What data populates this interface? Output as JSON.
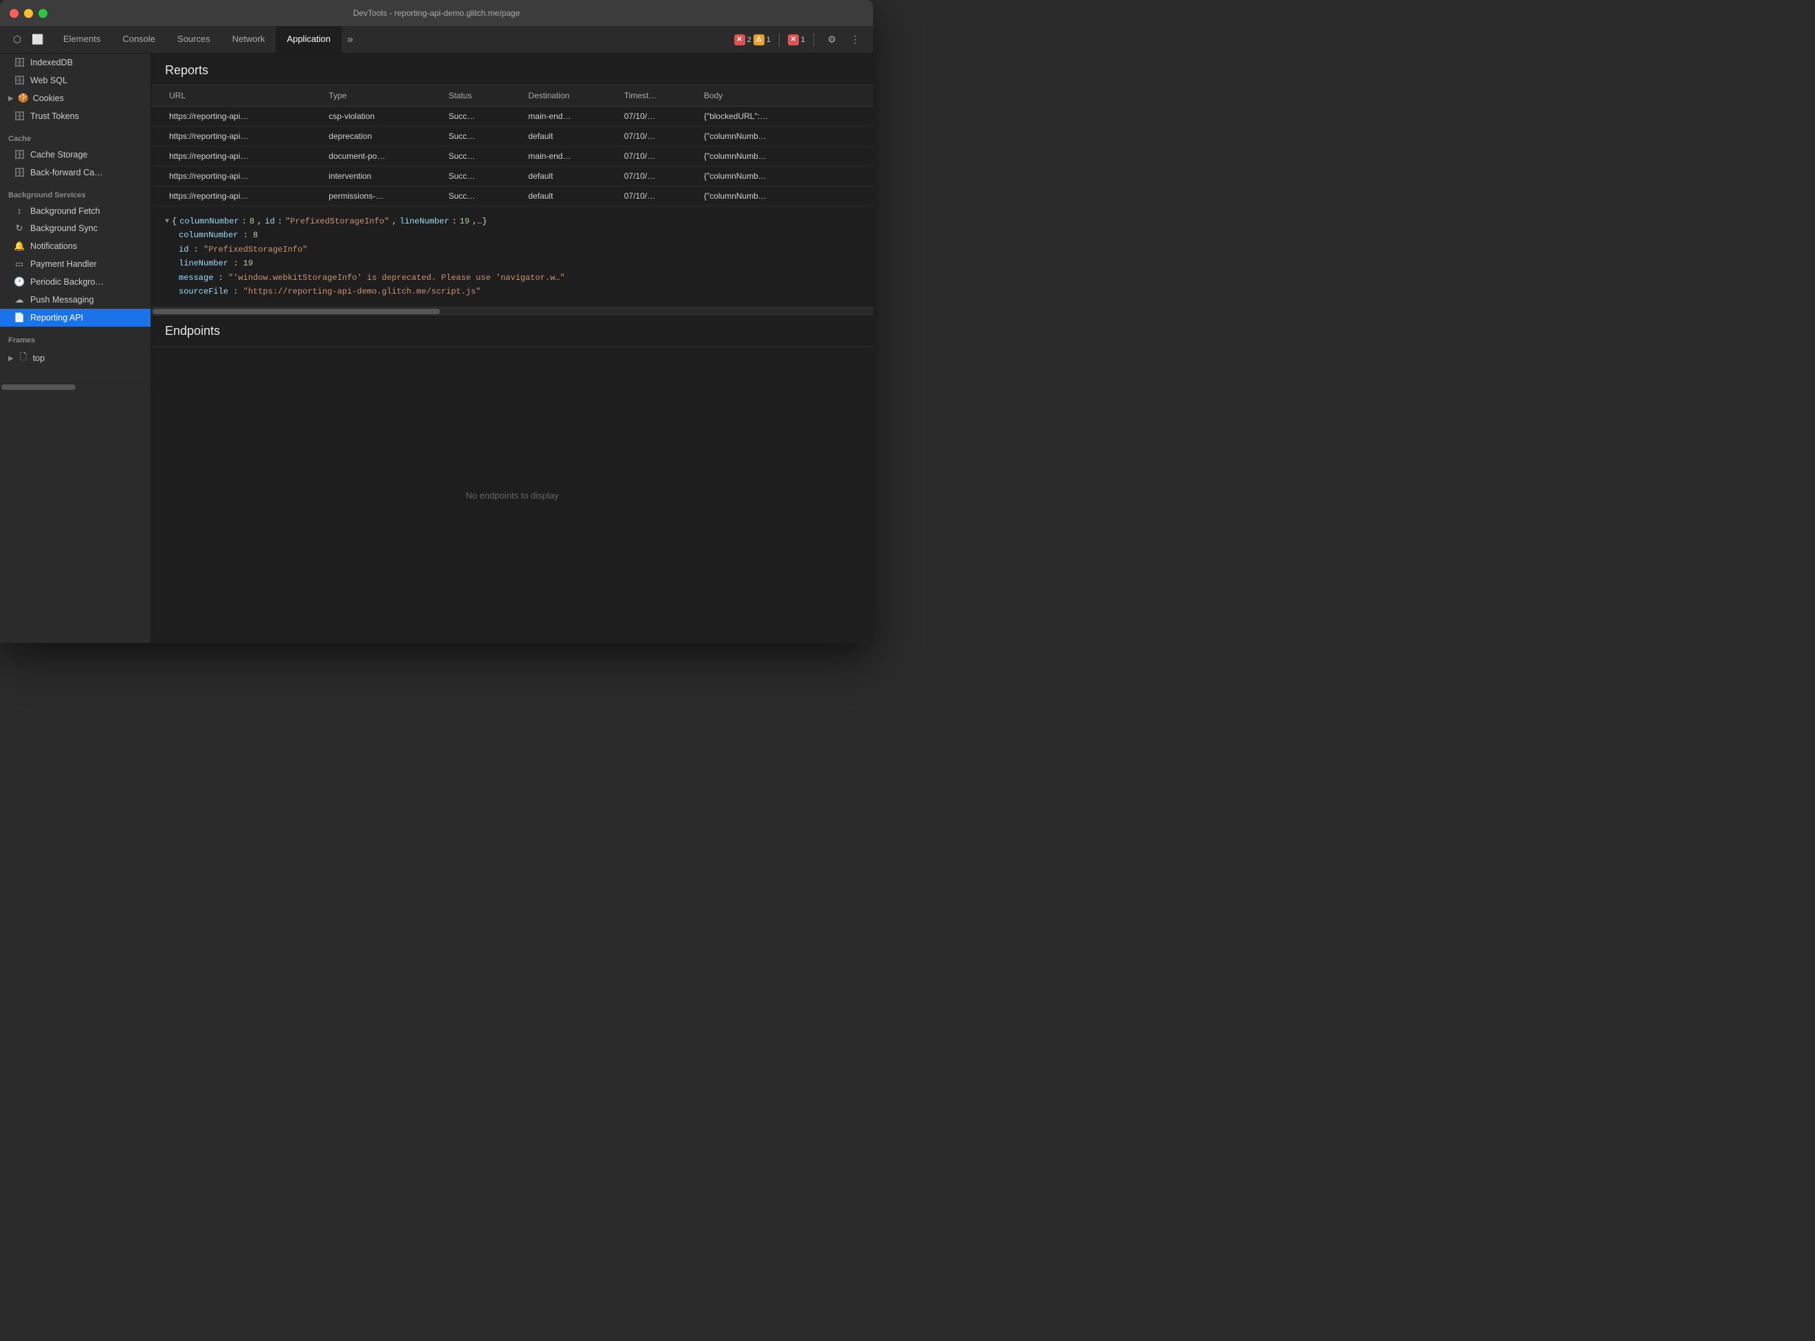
{
  "titleBar": {
    "title": "DevTools - reporting-api-demo.glitch.me/page"
  },
  "tabs": {
    "items": [
      {
        "label": "Elements",
        "active": false
      },
      {
        "label": "Console",
        "active": false
      },
      {
        "label": "Sources",
        "active": false
      },
      {
        "label": "Network",
        "active": false
      },
      {
        "label": "Application",
        "active": true
      }
    ],
    "more": "»",
    "errors": {
      "errorCount": "2",
      "warnCount": "1",
      "errorIcon2Count": "1"
    }
  },
  "sidebar": {
    "sections": [
      {
        "items": [
          {
            "label": "IndexedDB",
            "icon": "🗄",
            "indent": true
          },
          {
            "label": "Web SQL",
            "icon": "🗄",
            "indent": true
          },
          {
            "label": "Cookies",
            "icon": "🍪",
            "hasChevron": true,
            "indent": false
          },
          {
            "label": "Trust Tokens",
            "icon": "🗄",
            "indent": true
          }
        ]
      },
      {
        "sectionLabel": "Cache",
        "items": [
          {
            "label": "Cache Storage",
            "icon": "🗄",
            "indent": true
          },
          {
            "label": "Back-forward Ca…",
            "icon": "🗄",
            "indent": true
          }
        ]
      },
      {
        "sectionLabel": "Background Services",
        "items": [
          {
            "label": "Background Fetch",
            "icon": "↕",
            "indent": true
          },
          {
            "label": "Background Sync",
            "icon": "↻",
            "indent": true
          },
          {
            "label": "Notifications",
            "icon": "🔔",
            "indent": true
          },
          {
            "label": "Payment Handler",
            "icon": "💳",
            "indent": true
          },
          {
            "label": "Periodic Backgro…",
            "icon": "🕐",
            "indent": true
          },
          {
            "label": "Push Messaging",
            "icon": "☁",
            "indent": true
          },
          {
            "label": "Reporting API",
            "icon": "📄",
            "indent": true,
            "active": true
          }
        ]
      },
      {
        "sectionLabel": "Frames",
        "items": [
          {
            "label": "top",
            "icon": "🗋",
            "hasChevron": true,
            "indent": false
          }
        ]
      }
    ]
  },
  "reports": {
    "sectionTitle": "Reports",
    "table": {
      "headers": [
        "URL",
        "Type",
        "Status",
        "Destination",
        "Timest…",
        "Body"
      ],
      "rows": [
        {
          "url": "https://reporting-api…",
          "type": "csp-violation",
          "status": "Succ…",
          "destination": "main-end…",
          "timestamp": "07/10/…",
          "body": "{\"blockedURL\":…"
        },
        {
          "url": "https://reporting-api…",
          "type": "deprecation",
          "status": "Succ…",
          "destination": "default",
          "timestamp": "07/10/…",
          "body": "{\"columnNumb…"
        },
        {
          "url": "https://reporting-api…",
          "type": "document-po…",
          "status": "Succ…",
          "destination": "main-end…",
          "timestamp": "07/10/…",
          "body": "{\"columnNumb…"
        },
        {
          "url": "https://reporting-api…",
          "type": "intervention",
          "status": "Succ…",
          "destination": "default",
          "timestamp": "07/10/…",
          "body": "{\"columnNumb…"
        },
        {
          "url": "https://reporting-api…",
          "type": "permissions-…",
          "status": "Succ…",
          "destination": "default",
          "timestamp": "07/10/…",
          "body": "{\"columnNumb…"
        }
      ]
    },
    "jsonPreview": {
      "summary": "{columnNumber: 8, id: \"PrefixedStorageInfo\", lineNumber: 19,…}",
      "fields": [
        {
          "key": "columnNumber",
          "value": "8",
          "type": "num"
        },
        {
          "key": "id",
          "value": "\"PrefixedStorageInfo\"",
          "type": "str"
        },
        {
          "key": "lineNumber",
          "value": "19",
          "type": "num"
        },
        {
          "key": "message",
          "value": "\"'window.webkitStorageInfo' is deprecated. Please use 'navigator.w…\"",
          "type": "str"
        },
        {
          "key": "sourceFile",
          "value": "\"https://reporting-api-demo.glitch.me/script.js\"",
          "type": "str"
        }
      ]
    }
  },
  "endpoints": {
    "sectionTitle": "Endpoints",
    "emptyMessage": "No endpoints to display"
  }
}
